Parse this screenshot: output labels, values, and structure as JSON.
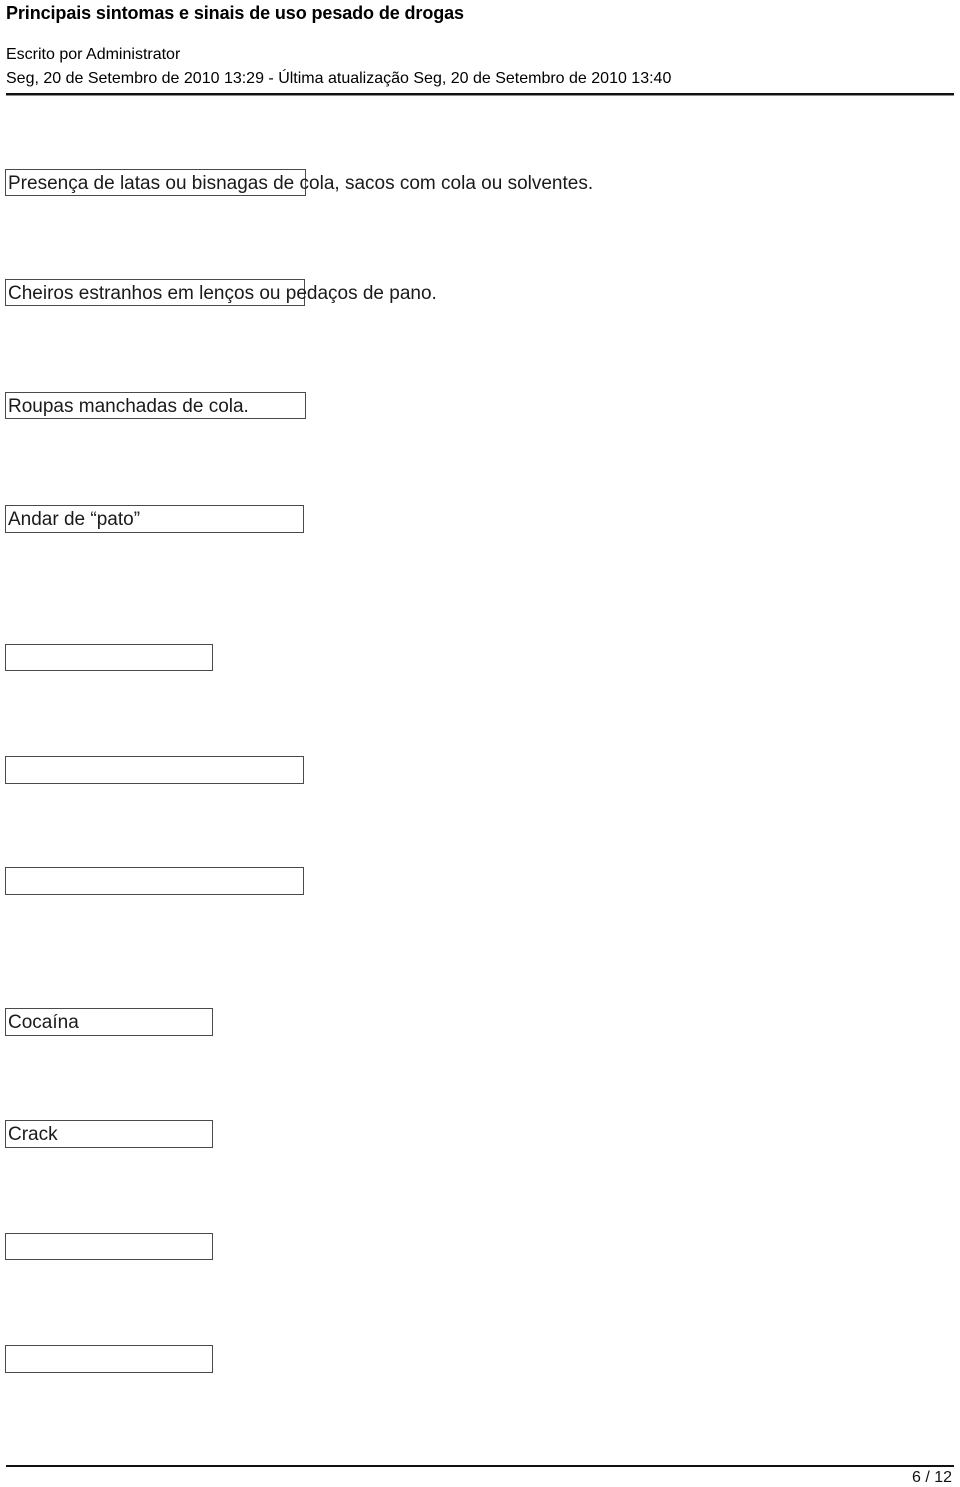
{
  "document": {
    "title": "Principais sintomas e sinais de uso pesado de drogas",
    "byline": "Escrito por Administrator",
    "dateline": "Seg, 20 de Setembro de 2010 13:29 - Última atualização Seg, 20 de Setembro de 2010 13:40"
  },
  "content": {
    "paragraphs": [
      {
        "text": "Presença de latas ou bisnagas de cola, sacos com cola ou solventes."
      },
      {
        "text": "Cheiros estranhos em lenços ou pedaços de pano."
      },
      {
        "text": "Roupas manchadas de cola."
      },
      {
        "text": "Andar de “pato”"
      }
    ],
    "boxes": [
      {
        "label": "",
        "name": "empty-box-1"
      },
      {
        "label": "",
        "name": "empty-box-2"
      },
      {
        "label": "",
        "name": "empty-box-3"
      },
      {
        "label": "Cocaína",
        "name": "box-cocaina"
      },
      {
        "label": "Crack",
        "name": "box-crack"
      },
      {
        "label": "",
        "name": "empty-box-4"
      },
      {
        "label": "",
        "name": "empty-box-5"
      }
    ]
  },
  "footer": {
    "page_number": "6 / 12"
  },
  "colors": {
    "text": "#1a1a1a",
    "rule": "#111111",
    "box_border": "#4a4a4a",
    "background": "#ffffff"
  }
}
